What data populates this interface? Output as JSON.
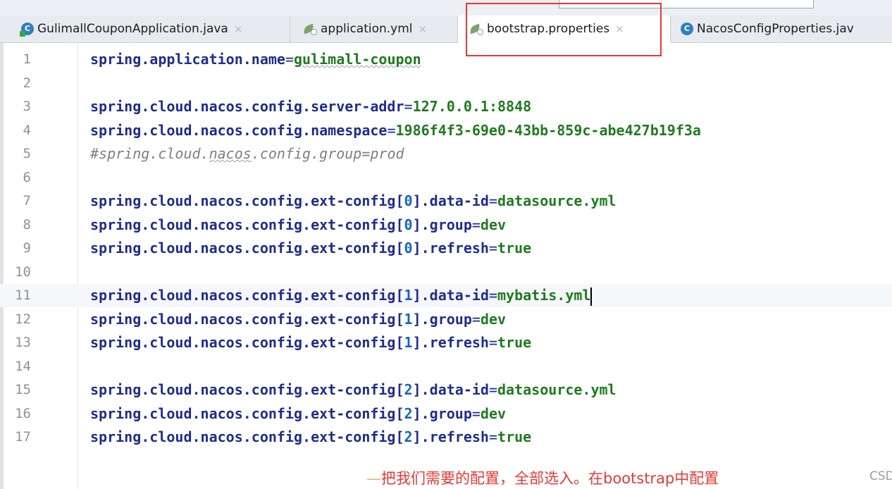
{
  "tabs": [
    {
      "label": "GulimallCouponApplication.java",
      "icon": "java-class-icon",
      "active": false
    },
    {
      "label": "application.yml",
      "icon": "spring-config-icon",
      "active": false
    },
    {
      "label": "bootstrap.properties",
      "icon": "spring-config-icon",
      "active": true
    },
    {
      "label": "NacosConfigProperties.jav",
      "icon": "class-icon",
      "active": false
    }
  ],
  "tab_close_glyph": "×",
  "highlight_color": "#e53935",
  "editor": {
    "current_line": 11,
    "lines": [
      {
        "n": "1",
        "key": "spring.application.name",
        "eq": "=",
        "value": "gulimall-coupon"
      },
      {
        "n": "2"
      },
      {
        "n": "3",
        "key": "spring.cloud.nacos.config.server-addr",
        "eq": "=",
        "value": "127.0.0.1:8848"
      },
      {
        "n": "4",
        "key": "spring.cloud.nacos.config.namespace",
        "eq": "=",
        "value": "1986f4f3-69e0-43bb-859c-abe427b19f3a"
      },
      {
        "n": "5",
        "comment": "#spring.cloud.nacos.config.group=prod"
      },
      {
        "n": "6"
      },
      {
        "n": "7",
        "key_pre": "spring.cloud.nacos.config.ext-config[",
        "idx": "0",
        "key_post": "].data-id",
        "eq": "=",
        "value": "datasource.yml"
      },
      {
        "n": "8",
        "key_pre": "spring.cloud.nacos.config.ext-config[",
        "idx": "0",
        "key_post": "].group",
        "eq": "=",
        "value": "dev"
      },
      {
        "n": "9",
        "key_pre": "spring.cloud.nacos.config.ext-config[",
        "idx": "0",
        "key_post": "].refresh",
        "eq": "=",
        "value": "true"
      },
      {
        "n": "10"
      },
      {
        "n": "11",
        "key_pre": "spring.cloud.nacos.config.ext-config[",
        "idx": "1",
        "key_post": "].data-id",
        "eq": "=",
        "value": "mybatis.yml"
      },
      {
        "n": "12",
        "key_pre": "spring.cloud.nacos.config.ext-config[",
        "idx": "1",
        "key_post": "].group",
        "eq": "=",
        "value": "dev"
      },
      {
        "n": "13",
        "key_pre": "spring.cloud.nacos.config.ext-config[",
        "idx": "1",
        "key_post": "].refresh",
        "eq": "=",
        "value": "true"
      },
      {
        "n": "14"
      },
      {
        "n": "15",
        "key_pre": "spring.cloud.nacos.config.ext-config[",
        "idx": "2",
        "key_post": "].data-id",
        "eq": "=",
        "value": "datasource.yml"
      },
      {
        "n": "16",
        "key_pre": "spring.cloud.nacos.config.ext-config[",
        "idx": "2",
        "key_post": "].group",
        "eq": "=",
        "value": "dev"
      },
      {
        "n": "17",
        "key_pre": "spring.cloud.nacos.config.ext-config[",
        "idx": "2",
        "key_post": "].refresh",
        "eq": "=",
        "value": "true"
      }
    ]
  },
  "annotation": {
    "dash": "—",
    "text": "把我们需要的配置，全部选入。在bootstrap中配置",
    "color": "#e53935"
  },
  "watermark": "CSD"
}
